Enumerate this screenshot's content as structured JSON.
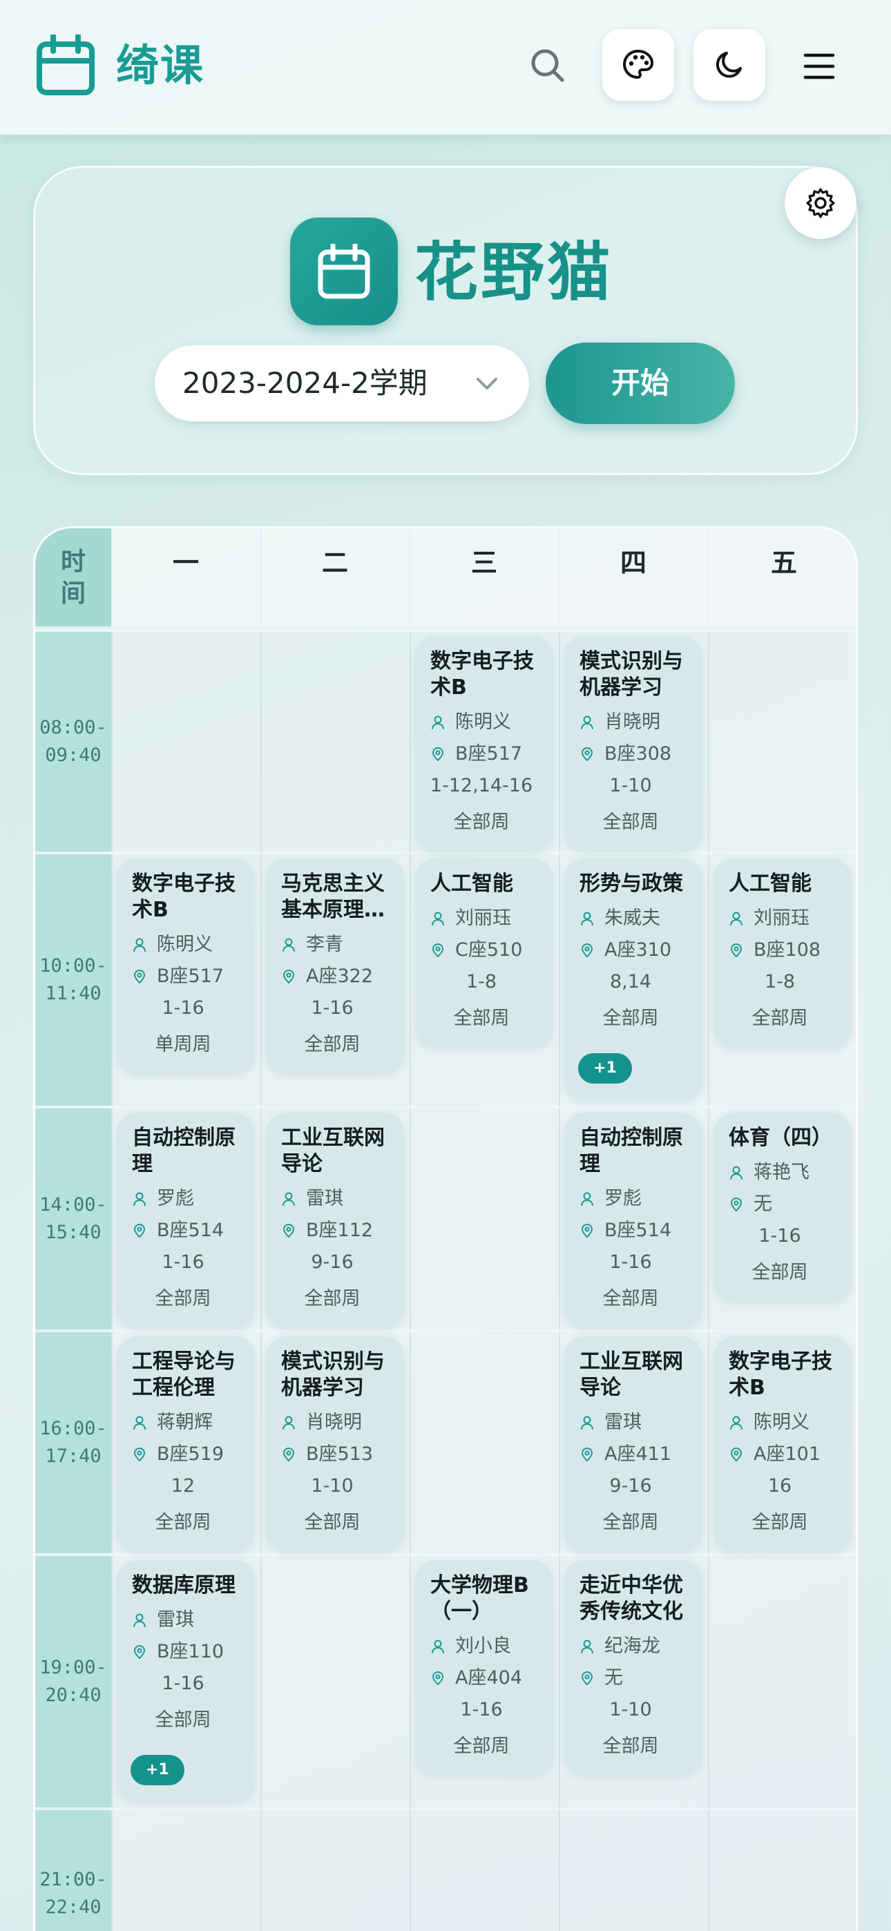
{
  "app": {
    "title": "绮课"
  },
  "hero": {
    "name": "花野猫",
    "term": "2023-2024-2学期",
    "start_label": "开始"
  },
  "table": {
    "time_header": "时间",
    "days": [
      "一",
      "二",
      "三",
      "四",
      "五"
    ],
    "slots": [
      {
        "start": "08:00-",
        "end": "09:40"
      },
      {
        "start": "10:00-",
        "end": "11:40"
      },
      {
        "start": "14:00-",
        "end": "15:40"
      },
      {
        "start": "16:00-",
        "end": "17:40"
      },
      {
        "start": "19:00-",
        "end": "20:40"
      },
      {
        "start": "21:00-",
        "end": "22:40"
      }
    ],
    "courses": [
      {
        "day": 2,
        "slot": 0,
        "name": "数字电子技术B",
        "teacher": "陈明义",
        "room": "B座517",
        "weeks": "1-12,14-16",
        "type": "全部周"
      },
      {
        "day": 3,
        "slot": 0,
        "name": "模式识别与机器学习",
        "teacher": "肖晓明",
        "room": "B座308",
        "weeks": "1-10",
        "type": "全部周"
      },
      {
        "day": 0,
        "slot": 1,
        "name": "数字电子技术B",
        "teacher": "陈明义",
        "room": "B座517",
        "weeks": "1-16",
        "type": "单周周"
      },
      {
        "day": 1,
        "slot": 1,
        "name": "马克思主义基本原理概论",
        "teacher": "李青",
        "room": "A座322",
        "weeks": "1-16",
        "type": "全部周"
      },
      {
        "day": 2,
        "slot": 1,
        "name": "人工智能",
        "teacher": "刘丽珏",
        "room": "C座510",
        "weeks": "1-8",
        "type": "全部周"
      },
      {
        "day": 3,
        "slot": 1,
        "name": "形势与政策",
        "teacher": "朱威夫",
        "room": "A座310",
        "weeks": "8,14",
        "type": "全部周",
        "more": "+1"
      },
      {
        "day": 4,
        "slot": 1,
        "name": "人工智能",
        "teacher": "刘丽珏",
        "room": "B座108",
        "weeks": "1-8",
        "type": "全部周"
      },
      {
        "day": 0,
        "slot": 2,
        "name": "自动控制原理",
        "teacher": "罗彪",
        "room": "B座514",
        "weeks": "1-16",
        "type": "全部周"
      },
      {
        "day": 1,
        "slot": 2,
        "name": "工业互联网导论",
        "teacher": "雷琪",
        "room": "B座112",
        "weeks": "9-16",
        "type": "全部周"
      },
      {
        "day": 3,
        "slot": 2,
        "name": "自动控制原理",
        "teacher": "罗彪",
        "room": "B座514",
        "weeks": "1-16",
        "type": "全部周"
      },
      {
        "day": 4,
        "slot": 2,
        "name": "体育（四）",
        "teacher": "蒋艳飞",
        "room": "无",
        "weeks": "1-16",
        "type": "全部周"
      },
      {
        "day": 0,
        "slot": 3,
        "name": "工程导论与工程伦理",
        "teacher": "蒋朝辉",
        "room": "B座519",
        "weeks": "12",
        "type": "全部周"
      },
      {
        "day": 1,
        "slot": 3,
        "name": "模式识别与机器学习",
        "teacher": "肖晓明",
        "room": "B座513",
        "weeks": "1-10",
        "type": "全部周"
      },
      {
        "day": 3,
        "slot": 3,
        "name": "工业互联网导论",
        "teacher": "雷琪",
        "room": "A座411",
        "weeks": "9-16",
        "type": "全部周"
      },
      {
        "day": 4,
        "slot": 3,
        "name": "数字电子技术B",
        "teacher": "陈明义",
        "room": "A座101",
        "weeks": "16",
        "type": "全部周"
      },
      {
        "day": 0,
        "slot": 4,
        "name": "数据库原理",
        "teacher": "雷琪",
        "room": "B座110",
        "weeks": "1-16",
        "type": "全部周",
        "more": "+1"
      },
      {
        "day": 2,
        "slot": 4,
        "name": "大学物理B（一）",
        "teacher": "刘小良",
        "room": "A座404",
        "weeks": "1-16",
        "type": "全部周"
      },
      {
        "day": 3,
        "slot": 4,
        "name": "走近中华优秀传统文化",
        "teacher": "纪海龙",
        "room": "无",
        "weeks": "1-10",
        "type": "全部周"
      }
    ]
  },
  "icons": {
    "logo": "calendar-icon",
    "search": "search-icon",
    "palette": "palette-icon",
    "theme": "moon-icon",
    "menu": "menu-icon",
    "settings": "gear-icon"
  },
  "colors": {
    "accent": "#199c94",
    "time_column": "#b5e1dd",
    "card": "#d8e8ea",
    "badge": "#14938e"
  }
}
